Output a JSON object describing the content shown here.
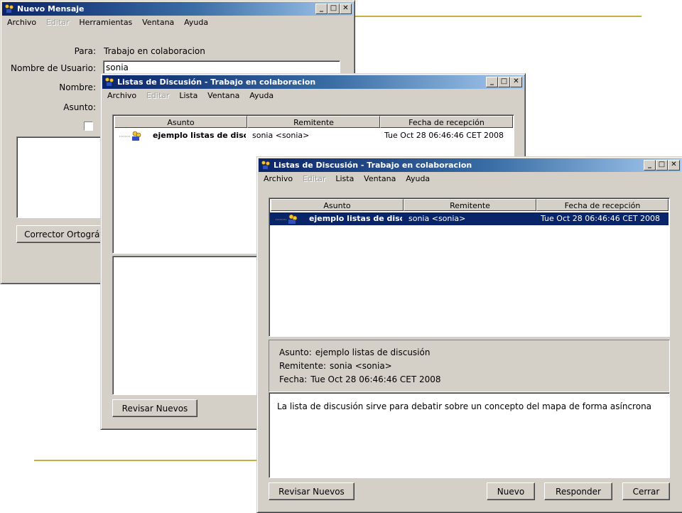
{
  "colors": {
    "titlebar_start": "#0a246a",
    "titlebar_end": "#a6caf0",
    "selection": "#0a246a",
    "window_face": "#d4d0c8",
    "deco_line": "#c8b040"
  },
  "window_controls": {
    "minimize_icon": "minimize-icon",
    "maximize_icon": "maximize-icon",
    "close_icon": "close-icon"
  },
  "win1": {
    "title": "Nuevo Mensaje",
    "menu": [
      "Archivo",
      "Editar",
      "Herramientas",
      "Ventana",
      "Ayuda"
    ],
    "para_label": "Para:",
    "para_value": "Trabajo en colaboracion",
    "usuario_label": "Nombre de Usuario:",
    "usuario_value": "sonia",
    "nombre_label": "Nombre:",
    "asunto_label": "Asunto:",
    "corrector_button": "Corrector Ortográfico"
  },
  "win2": {
    "title": "Listas de Discusión - Trabajo en colaboracion",
    "menu": [
      "Archivo",
      "Editar",
      "Lista",
      "Ventana",
      "Ayuda"
    ],
    "columns": [
      "Asunto",
      "Remitente",
      "Fecha de recepción"
    ],
    "rows": [
      {
        "asunto": "ejemplo listas de discusión",
        "remitente": "sonia <sonia>",
        "fecha": "Tue Oct 28 06:46:46 CET 2008"
      }
    ],
    "revisar_button": "Revisar Nuevos"
  },
  "win3": {
    "title": "Listas de Discusión - Trabajo en colaboracion",
    "menu": [
      "Archivo",
      "Editar",
      "Lista",
      "Ventana",
      "Ayuda"
    ],
    "columns": [
      "Asunto",
      "Remitente",
      "Fecha de recepción"
    ],
    "rows": [
      {
        "asunto": "ejemplo listas de discusión",
        "remitente": "sonia <sonia>",
        "fecha": "Tue Oct 28 06:46:46 CET 2008"
      }
    ],
    "detail": {
      "asunto_label": "Asunto:",
      "asunto_value": "ejemplo listas de discusión",
      "remitente_label": "Remitente:",
      "remitente_value": "sonia <sonia>",
      "fecha_label": "Fecha:",
      "fecha_value": "Tue Oct 28 06:46:46 CET 2008"
    },
    "body_text": "La lista de discusión sirve para debatir sobre un concepto del mapa de forma asíncrona",
    "buttons": {
      "revisar": "Revisar Nuevos",
      "nuevo": "Nuevo",
      "responder": "Responder",
      "cerrar": "Cerrar"
    }
  }
}
